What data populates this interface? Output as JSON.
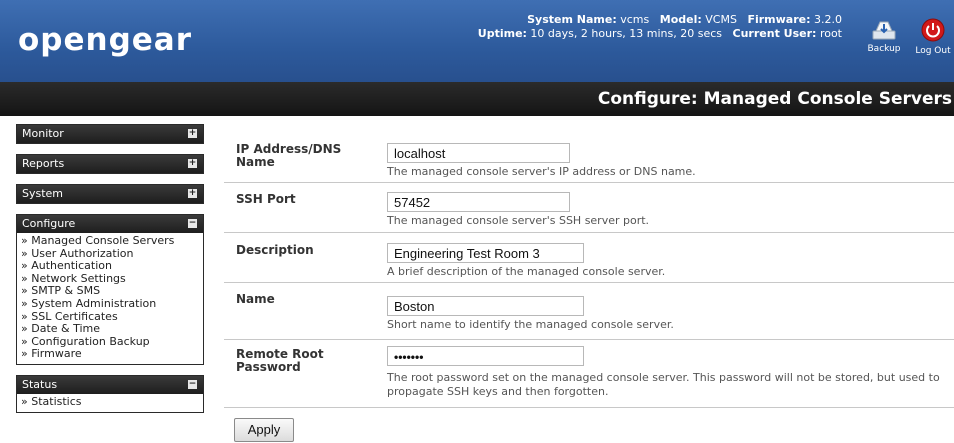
{
  "header": {
    "logo": "opengear",
    "system_name_label": "System Name:",
    "system_name": "vcms",
    "model_label": "Model:",
    "model": "VCMS",
    "firmware_label": "Firmware:",
    "firmware": "3.2.0",
    "uptime_label": "Uptime:",
    "uptime": "10 days, 2 hours, 13 mins, 20 secs",
    "user_label": "Current User:",
    "user": "root",
    "backup_label": "Backup",
    "logout_label": "Log Out",
    "accent": "#2d5a9c",
    "logout_color": "#d11919"
  },
  "page_title": "Configure: Managed Console Servers",
  "sidebar": {
    "monitor": "Monitor",
    "reports": "Reports",
    "system": "System",
    "configure": "Configure",
    "configure_items": [
      "» Managed Console Servers",
      "» User Authorization",
      "» Authentication",
      "» Network Settings",
      "» SMTP & SMS",
      "» System Administration",
      "» SSL Certificates",
      "» Date & Time",
      "» Configuration Backup",
      "» Firmware"
    ],
    "status": "Status",
    "status_items": [
      "» Statistics"
    ],
    "expand_glyph": "+",
    "collapse_glyph": "−"
  },
  "form": {
    "ip_label": "IP Address/DNS Name",
    "ip_value": "localhost",
    "ip_hint": "The managed console server's IP address or DNS name.",
    "ssh_label": "SSH Port",
    "ssh_value": "57452",
    "ssh_hint": "The managed console server's SSH server port.",
    "desc_label": "Description",
    "desc_value": "Engineering Test Room 3",
    "desc_hint": "A brief description of the managed console server.",
    "name_label": "Name",
    "name_value": "Boston",
    "name_hint": "Short name to identify the managed console server.",
    "pw_label": "Remote Root Password",
    "pw_value": "•••••••",
    "pw_hint": "The root password set on the managed console server. This password will not be stored, but used to propagate SSH keys and then forgotten.",
    "apply_label": "Apply"
  }
}
